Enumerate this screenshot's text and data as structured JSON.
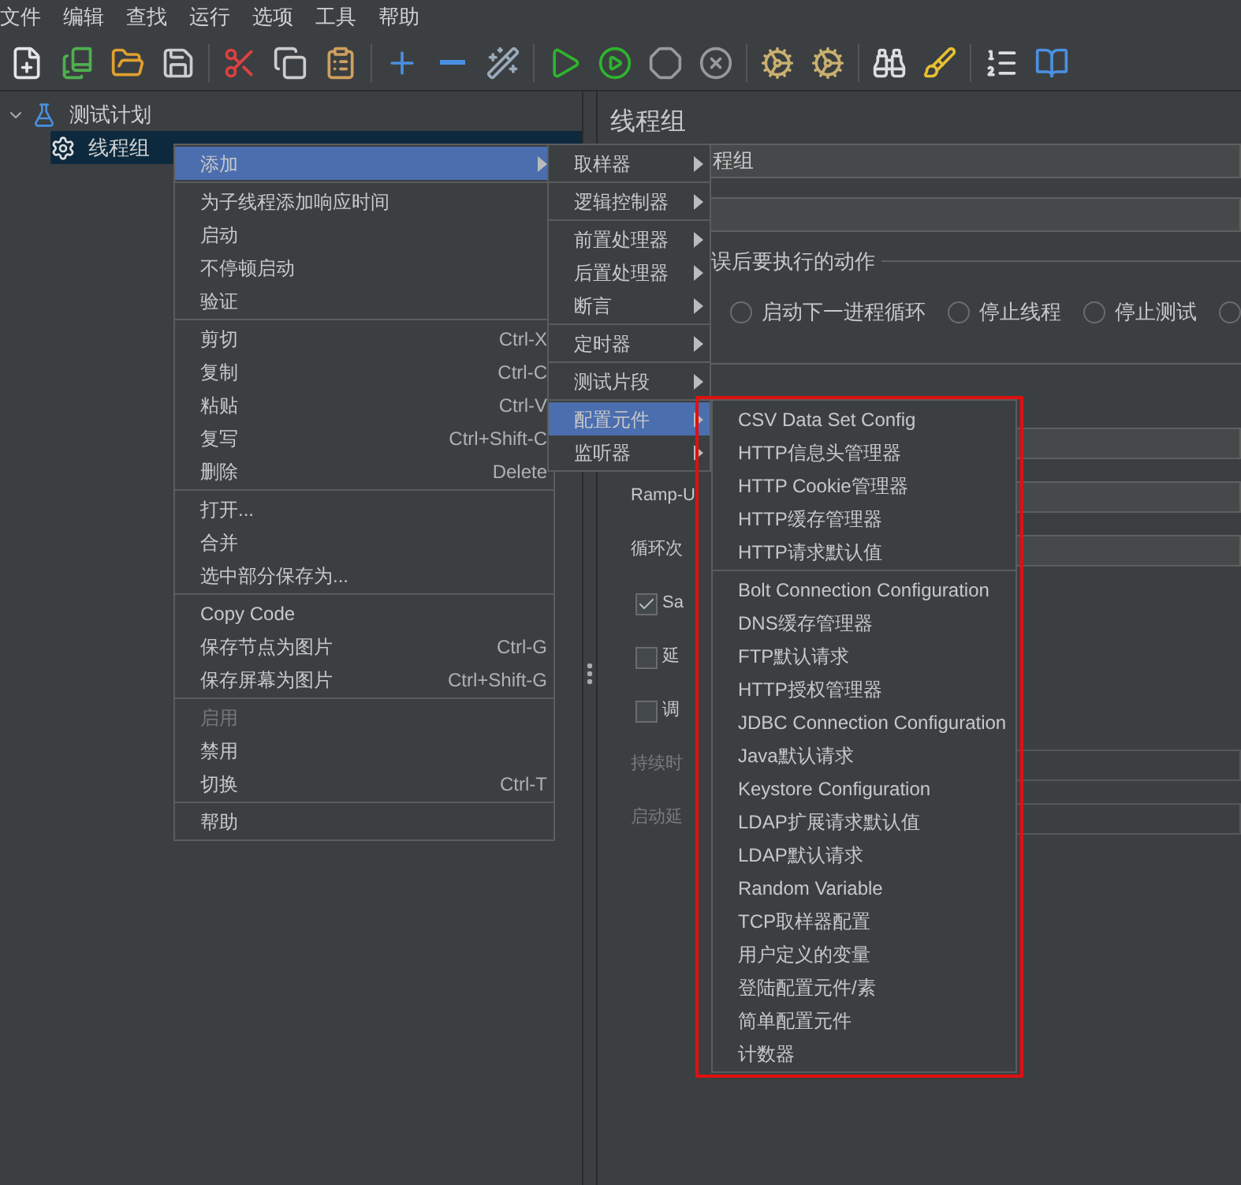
{
  "menu_bar": [
    "文件",
    "编辑",
    "查找",
    "运行",
    "选项",
    "工具",
    "帮助"
  ],
  "tree": [
    {
      "label": "测试计划",
      "expanded": true,
      "selected": false,
      "children": [
        {
          "label": "线程组",
          "selected": true
        }
      ]
    }
  ],
  "panel": {
    "title": "线程组",
    "name_value": "程组",
    "error_action_label": "误后要执行的动作",
    "error_actions": [
      {
        "label": "启动下一进程循环",
        "selected": false
      },
      {
        "label": "停止线程",
        "selected": false
      },
      {
        "label": "停止测试",
        "selected": false
      },
      {
        "selected": false
      }
    ],
    "rows": [
      {
        "kind": "field"
      },
      {
        "kind": "field",
        "label": "Ramp-U",
        "disabled": false
      },
      {
        "kind": "field",
        "label": "循环次",
        "disabled": false
      },
      {
        "kind": "checkbox",
        "label": "Sa",
        "checked": true,
        "disabled": false
      },
      {
        "kind": "checkbox",
        "label": "延",
        "checked": false,
        "disabled": false
      },
      {
        "kind": "checkbox",
        "label": "调",
        "checked": false,
        "disabled": false
      },
      {
        "kind": "field",
        "label": "持续时",
        "disabled": true
      },
      {
        "kind": "field",
        "label": "启动延",
        "disabled": true
      }
    ]
  },
  "context_menu": [
    [
      {
        "label": "添加",
        "submenu": true,
        "selected": true,
        "disabled": false
      }
    ],
    [
      {
        "label": "为子线程添加响应时间",
        "selected": false,
        "disabled": false
      },
      {
        "label": "启动",
        "selected": false,
        "disabled": false
      },
      {
        "label": "不停顿启动",
        "selected": false,
        "disabled": false
      },
      {
        "label": "验证",
        "selected": false,
        "disabled": false
      }
    ],
    [
      {
        "label": "剪切",
        "shortcut": "Ctrl-X",
        "selected": false,
        "disabled": false
      },
      {
        "label": "复制",
        "shortcut": "Ctrl-C",
        "selected": false,
        "disabled": false
      },
      {
        "label": "粘贴",
        "shortcut": "Ctrl-V",
        "selected": false,
        "disabled": false
      },
      {
        "label": "复写",
        "shortcut": "Ctrl+Shift-C",
        "selected": false,
        "disabled": false
      },
      {
        "label": "删除",
        "shortcut": "Delete",
        "selected": false,
        "disabled": false
      }
    ],
    [
      {
        "label": "打开...",
        "selected": false,
        "disabled": false
      },
      {
        "label": "合并",
        "selected": false,
        "disabled": false
      },
      {
        "label": "选中部分保存为...",
        "selected": false,
        "disabled": false
      }
    ],
    [
      {
        "label": "Copy Code",
        "selected": false,
        "disabled": false
      },
      {
        "label": "保存节点为图片",
        "shortcut": "Ctrl-G",
        "selected": false,
        "disabled": false
      },
      {
        "label": "保存屏幕为图片",
        "shortcut": "Ctrl+Shift-G",
        "selected": false,
        "disabled": false
      }
    ],
    [
      {
        "label": "启用",
        "selected": false,
        "disabled": true
      },
      {
        "label": "禁用",
        "selected": false,
        "disabled": false
      },
      {
        "label": "切换",
        "shortcut": "Ctrl-T",
        "selected": false,
        "disabled": false
      }
    ],
    [
      {
        "label": "帮助",
        "selected": false,
        "disabled": false
      }
    ]
  ],
  "add_submenu": [
    [
      {
        "label": "取样器",
        "submenu": true,
        "selected": false
      }
    ],
    [
      {
        "label": "逻辑控制器",
        "submenu": true,
        "selected": false
      }
    ],
    [
      {
        "label": "前置处理器",
        "submenu": true,
        "selected": false
      },
      {
        "label": "后置处理器",
        "submenu": true,
        "selected": false
      },
      {
        "label": "断言",
        "submenu": true,
        "selected": false
      }
    ],
    [
      {
        "label": "定时器",
        "submenu": true,
        "selected": false
      }
    ],
    [
      {
        "label": "测试片段",
        "submenu": true,
        "selected": false
      }
    ],
    [
      {
        "label": "配置元件",
        "submenu": true,
        "selected": true
      },
      {
        "label": "监听器",
        "submenu": true,
        "selected": false
      }
    ]
  ],
  "config_submenu": [
    [
      {
        "label": "CSV Data Set Config",
        "selected": false
      },
      {
        "label": "HTTP信息头管理器",
        "selected": false
      },
      {
        "label": "HTTP Cookie管理器",
        "selected": false
      },
      {
        "label": "HTTP缓存管理器",
        "selected": false
      },
      {
        "label": "HTTP请求默认值",
        "selected": false
      }
    ],
    [
      {
        "label": "Bolt Connection Configuration",
        "selected": false
      },
      {
        "label": "DNS缓存管理器",
        "selected": false
      },
      {
        "label": "FTP默认请求",
        "selected": false
      },
      {
        "label": "HTTP授权管理器",
        "selected": false
      },
      {
        "label": "JDBC Connection Configuration",
        "selected": false
      },
      {
        "label": "Java默认请求",
        "selected": false
      },
      {
        "label": "Keystore Configuration",
        "selected": false
      },
      {
        "label": "LDAP扩展请求默认值",
        "selected": false
      },
      {
        "label": "LDAP默认请求",
        "selected": false
      },
      {
        "label": "Random Variable",
        "selected": false
      },
      {
        "label": "TCP取样器配置",
        "selected": false
      },
      {
        "label": "用户定义的变量",
        "selected": false
      },
      {
        "label": "登陆配置元件/素",
        "selected": false
      },
      {
        "label": "简单配置元件",
        "selected": false
      },
      {
        "label": "计数器",
        "selected": false
      }
    ]
  ]
}
